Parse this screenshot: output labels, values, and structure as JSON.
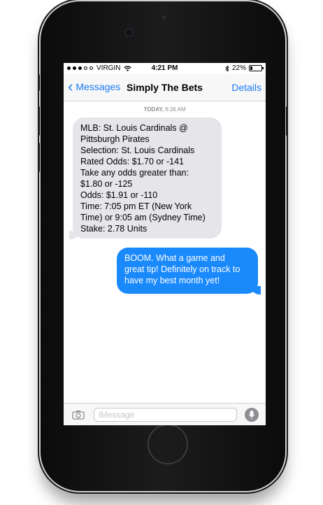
{
  "status_bar": {
    "carrier": "VIRGIN",
    "time": "4:21 PM",
    "battery": "22%",
    "battery_level": 0.22,
    "icons": [
      "wifi-icon",
      "bluetooth-icon",
      "battery-icon"
    ]
  },
  "nav": {
    "back_label": "Messages",
    "title": "Simply The Bets",
    "details_label": "Details"
  },
  "timestamp": {
    "day": "TODAY,",
    "time": "6:26 AM"
  },
  "messages": [
    {
      "direction": "incoming",
      "lines": [
        "MLB: St. Louis Cardinals @",
        "Pittsburgh Pirates",
        "Selection: St. Louis Cardinals",
        "Rated Odds: $1.70 or -141",
        "Take any odds greater than:",
        "$1.80 or -125",
        "Odds: $1.91 or -110",
        "Time: 7:05 pm ET (New York",
        "Time) or 9:05 am (Sydney Time)",
        "Stake: 2.78 Units"
      ]
    },
    {
      "direction": "outgoing",
      "lines": [
        "BOOM. What a game and",
        "great tip! Definitely on track to",
        "have my best month yet!"
      ]
    }
  ],
  "composer": {
    "placeholder": "iMessage"
  },
  "colors": {
    "accent": "#1a7cf5",
    "outgoing_bubble": "#1a89fb",
    "incoming_bubble": "#e5e5ea"
  }
}
